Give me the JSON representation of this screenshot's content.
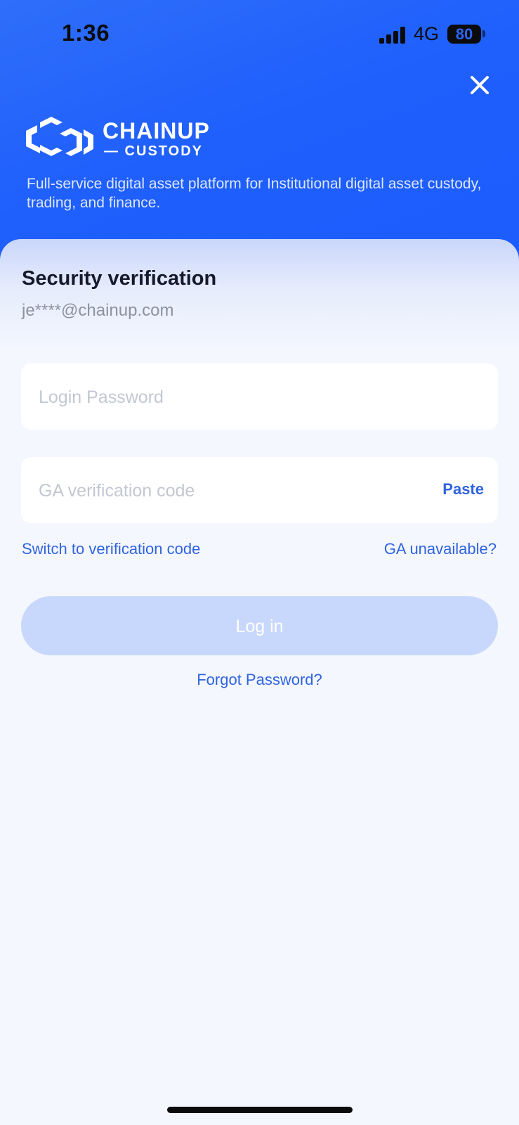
{
  "status_bar": {
    "time": "1:36",
    "network": "4G",
    "battery": "80"
  },
  "header": {
    "brand_top": "CHAINUP",
    "brand_bottom": "— CUSTODY",
    "tagline": "Full-service digital asset platform for Institutional digital asset custody, trading, and finance.",
    "close_icon": "close-icon"
  },
  "form": {
    "title": "Security verification",
    "email": "je****@chainup.com",
    "password_placeholder": "Login Password",
    "ga_placeholder": "GA verification code",
    "paste_label": "Paste",
    "switch_label": "Switch to verification code",
    "ga_unavailable_label": "GA unavailable?",
    "login_label": "Log in",
    "forgot_label": "Forgot Password?"
  },
  "colors": {
    "accent": "#2f63e0",
    "hero_blue": "#1f5ffc",
    "login_button_disabled": "#c8d8fc",
    "sheet_background": "#f4f7fe"
  }
}
